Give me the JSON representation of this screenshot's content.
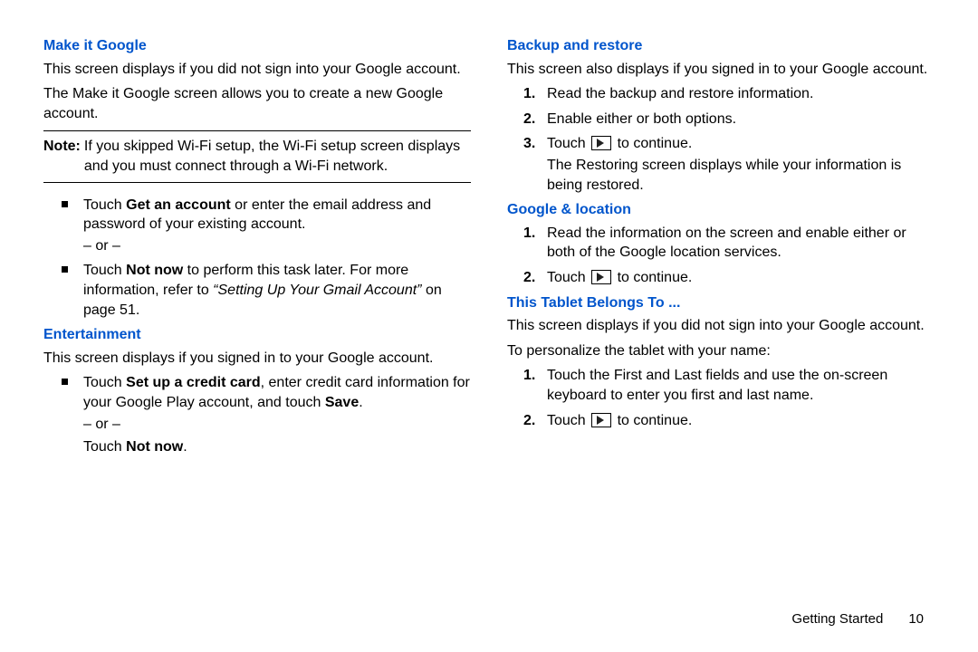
{
  "left": {
    "h1": "Make it Google",
    "p1": "This screen displays if you did not sign into your Google account.",
    "p2": "The Make it Google screen allows you to create a new Google account.",
    "note_label": "Note:",
    "note_text": "If you skipped Wi-Fi setup, the Wi-Fi setup screen displays and you must connect through a Wi-Fi network.",
    "b1_pre": "Touch ",
    "b1_bold": "Get an account",
    "b1_post": " or enter the email address and password of your existing account.",
    "or": "– or –",
    "b2_pre": "Touch ",
    "b2_bold": "Not now",
    "b2_post": " to perform this task later. For more information, refer to ",
    "b2_quote": "“Setting Up Your Gmail Account”",
    "b2_end": " on page 51.",
    "h2": "Entertainment",
    "p3": "This screen displays if you signed in to your Google account.",
    "c1_pre": "Touch ",
    "c1_bold": "Set up a credit card",
    "c1_mid": ", enter credit card information for your Google Play account, and touch ",
    "c1_bold2": "Save",
    "c1_end": ".",
    "c2_pre": "Touch ",
    "c2_bold": "Not now",
    "c2_end": "."
  },
  "right": {
    "h1": "Backup and restore",
    "p1": "This screen also displays if you signed in to your Google account.",
    "s1": "Read the backup and restore information.",
    "s2": "Enable either or both options.",
    "s3_pre": "Touch ",
    "s3_post": " to continue.",
    "s3_extra": "The Restoring screen displays while your information is being restored.",
    "h2": "Google & location",
    "g1": "Read the information on the screen and enable either or both of the Google location services.",
    "g2_pre": "Touch ",
    "g2_post": " to continue.",
    "h3": "This Tablet Belongs To ...",
    "p2": "This screen displays if you did not sign into your Google account.",
    "p3": "To personalize the tablet with your name:",
    "t1": "Touch the First and Last fields and use the on-screen keyboard to enter you first and last name.",
    "t2_pre": "Touch ",
    "t2_post": " to continue."
  },
  "footer": {
    "section": "Getting Started",
    "page": "10"
  }
}
